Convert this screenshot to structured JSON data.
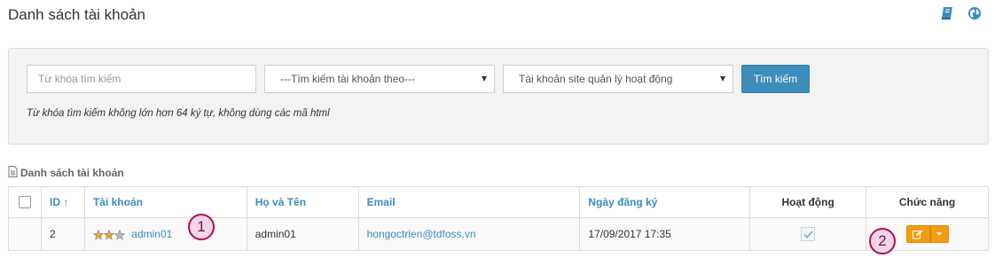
{
  "header": {
    "title": "Danh sách tài khoản"
  },
  "search": {
    "keyword_placeholder": "Từ khóa tìm kiếm",
    "keyword_value": "",
    "search_by_selected": "---Tìm kiếm tài khoản theo---",
    "site_filter_selected": "Tài khoản site quản lý hoạt động",
    "button_label": "Tìm kiếm",
    "hint": "Từ khóa tìm kiếm không lớn hơn 64 ký tự, không dùng các mã html"
  },
  "section": {
    "title": "Danh sách tài khoản"
  },
  "table": {
    "columns": {
      "id": "ID ↑",
      "account": "Tài khoản",
      "fullname": "Họ và Tên",
      "email": "Email",
      "registered": "Ngày đăng ký",
      "active": "Hoạt động",
      "actions": "Chức năng"
    },
    "rows": [
      {
        "id": "2",
        "account": "admin01",
        "stars": 3,
        "fullname": "admin01",
        "email": "hongoctrien@tdfoss.vn",
        "registered": "17/09/2017 17:35",
        "active": true
      }
    ]
  },
  "markers": {
    "one": "1",
    "two": "2"
  },
  "colors": {
    "primary": "#3c8dbc",
    "warning": "#f39c12",
    "marker": "#b00d5a"
  }
}
